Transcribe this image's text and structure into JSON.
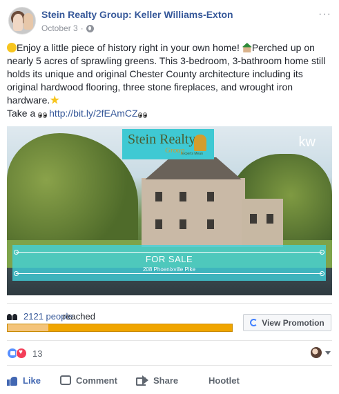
{
  "post": {
    "page_name": "Stein Realty Group: Keller Williams-Exton",
    "date": "October 3",
    "separator": "·",
    "more_label": "···",
    "text_line1_a": "Enjoy a little piece of history right in your own home! ",
    "text_line1_b": "Perched up on nearly 5 acres of sprawling greens. This 3-bedroom, 3-bathroom home still holds its unique and original Chester County architecture including its original hardwood flooring, three stone fireplaces, and wrought iron hardware.",
    "take_a": "Take a ",
    "link": "http://bit.ly/2fEAmCZ"
  },
  "image": {
    "logo_brand": "Stein Realty",
    "logo_group": "Group",
    "logo_tagline": "Experts Mean",
    "kw_logo": "kw",
    "banner_title": "FOR SALE",
    "banner_address": "208 Phoenixville Pike"
  },
  "insights": {
    "reach_count": "2121 people",
    "reach_label": "reached",
    "progress_fraction": 0.18,
    "view_promotion_label": "View Promotion"
  },
  "reactions": {
    "count": "13"
  },
  "actions": {
    "like": "Like",
    "comment": "Comment",
    "share": "Share",
    "hootlet": "Hootlet"
  },
  "colors": {
    "link_blue": "#365899",
    "promo_orange": "#f0a500",
    "banner_teal": "#40d2dc"
  }
}
